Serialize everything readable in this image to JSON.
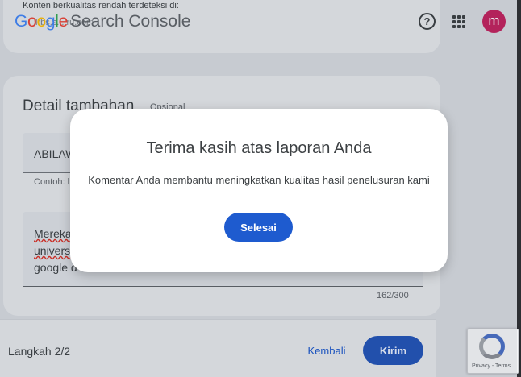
{
  "header": {
    "logo_letters": [
      "G",
      "o",
      "o",
      "g",
      "l",
      "e"
    ],
    "product_name": "Search Console",
    "avatar_letter": "m",
    "avatar_color": "#c1235e"
  },
  "top_card": {
    "notice": "Konten berkualitas rendah terdeteksi di:",
    "url_fragment": "lrbs.s... ru.com"
  },
  "detail_section": {
    "title": "Detail tambahan",
    "optional_label": "Opsional",
    "field_value": "ABILAW",
    "example_prefix": "Contoh: h",
    "textarea_lines": [
      "Mereka",
      "univers",
      "google d"
    ],
    "char_counter": "162/300"
  },
  "footer": {
    "step_label": "Langkah 2/2",
    "back_label": "Kembali",
    "send_label": "Kirim"
  },
  "recaptcha": {
    "links": "Privacy - Terms"
  },
  "dialog": {
    "title": "Terima kasih atas laporan Anda",
    "body": "Komentar Anda membantu meningkatkan kualitas hasil penelusuran kami",
    "done_label": "Selesai"
  },
  "colors": {
    "primary_button": "#1e5bcf",
    "link": "#1a56c9"
  }
}
